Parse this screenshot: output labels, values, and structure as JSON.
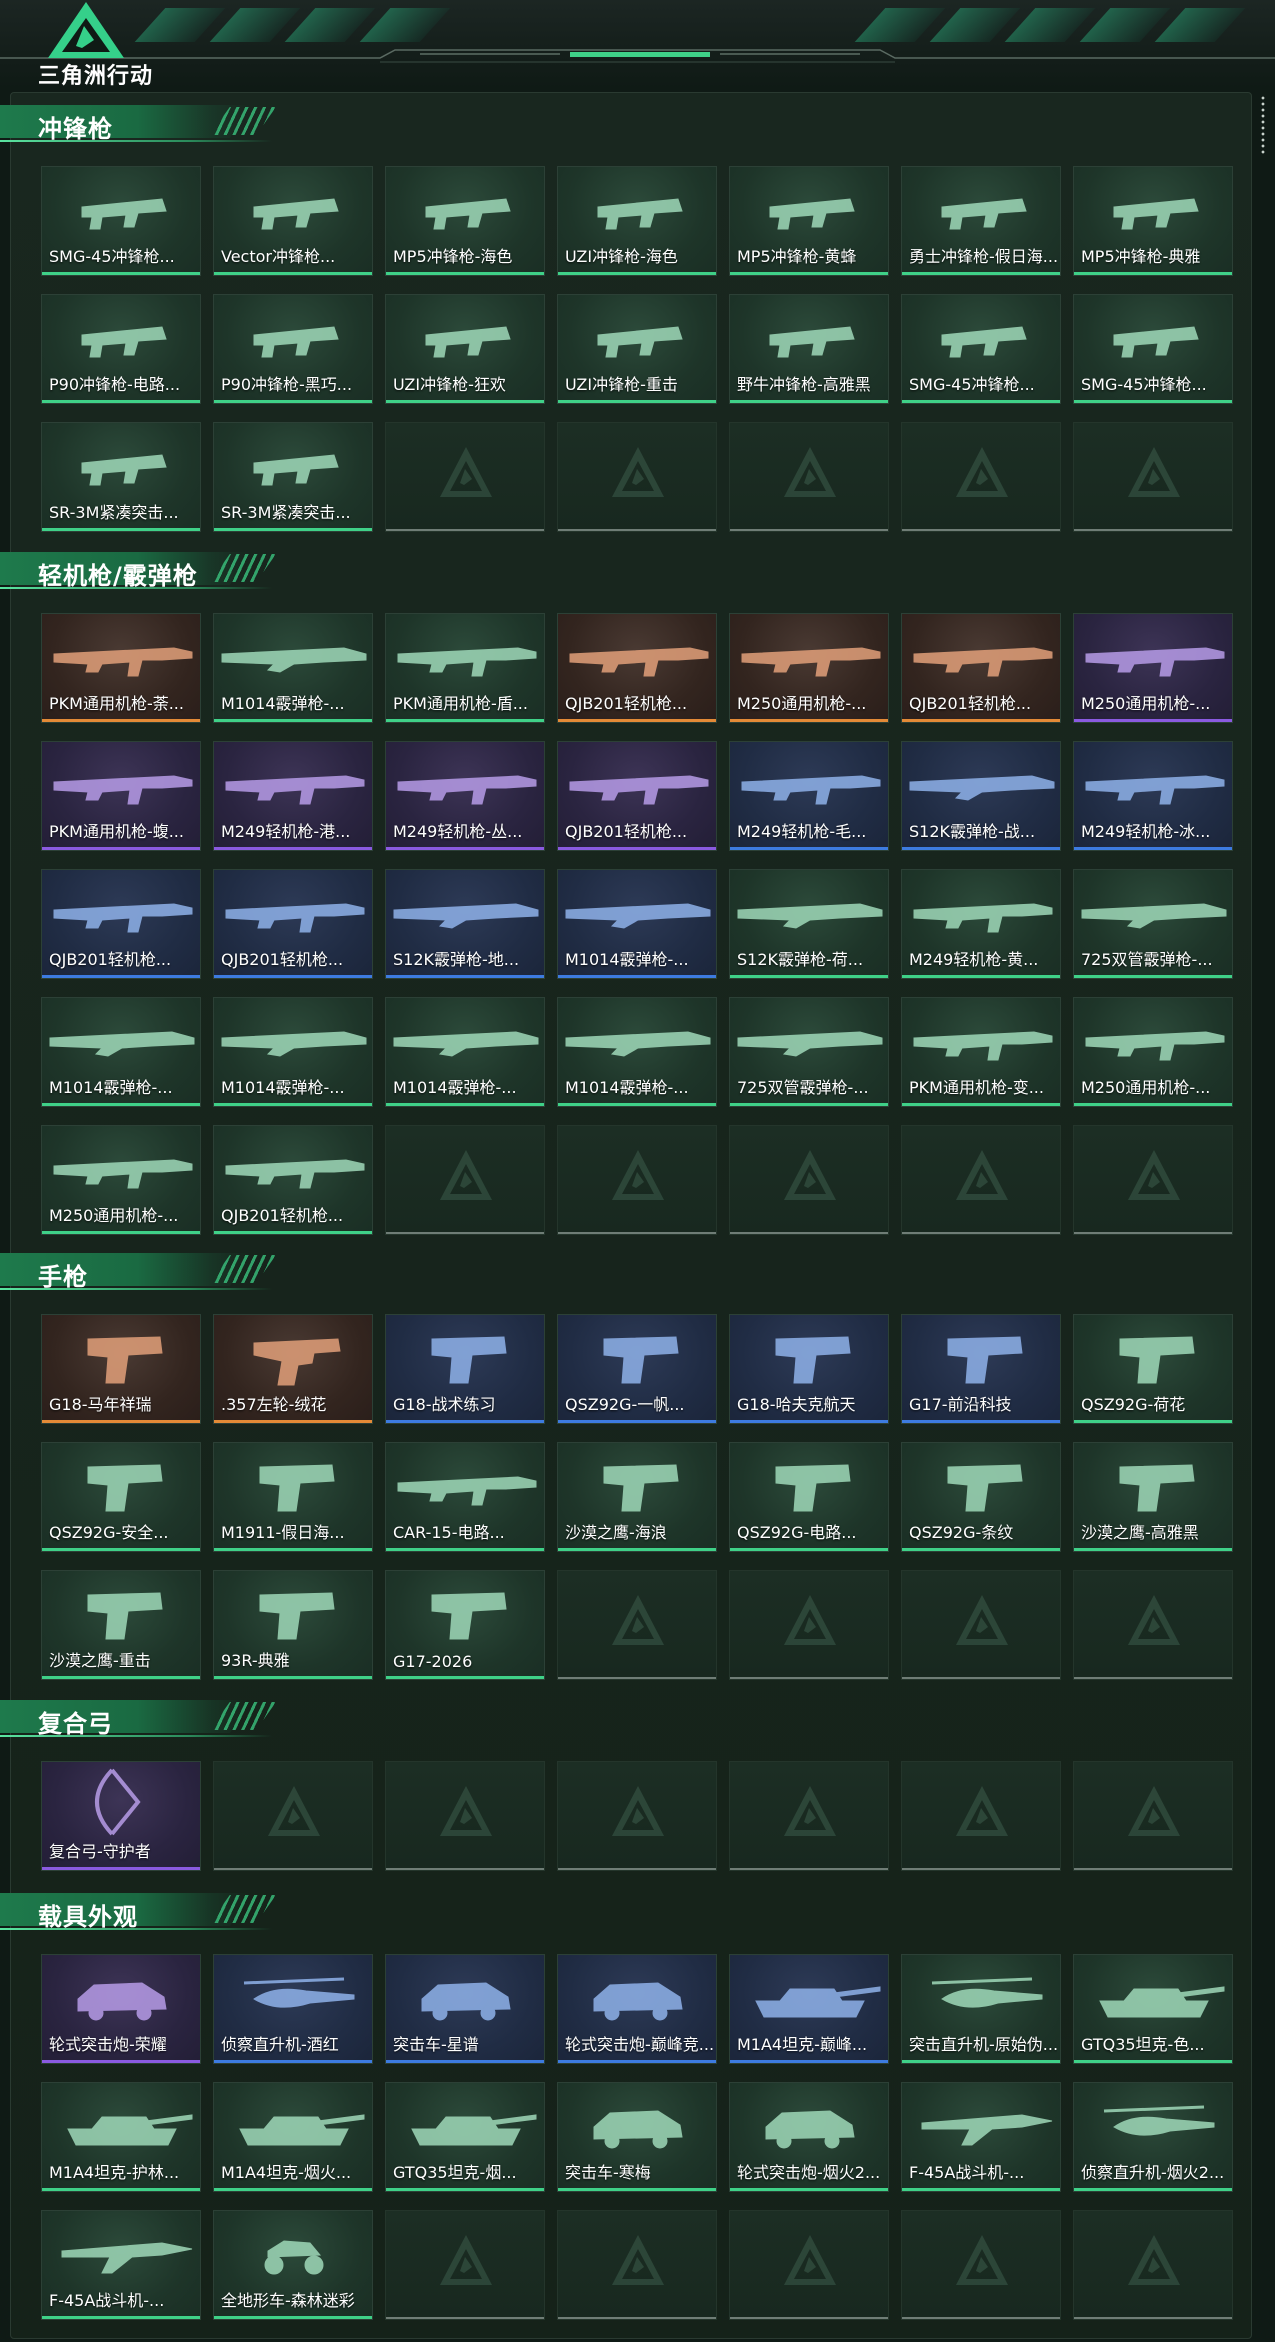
{
  "header": {
    "logo_text": "三角洲行动"
  },
  "colors": {
    "green": "#3fd188",
    "orange": "#e38a37",
    "purple": "#8a5ae0",
    "blue": "#3d7be0"
  },
  "sections": [
    {
      "title": "冲锋枪",
      "items": [
        {
          "name": "SMG-45冲锋枪...",
          "rarity": "green",
          "icon": "smg-icon"
        },
        {
          "name": "Vector冲锋枪...",
          "rarity": "green",
          "icon": "smg-icon"
        },
        {
          "name": "MP5冲锋枪-海色",
          "rarity": "green",
          "icon": "smg-icon"
        },
        {
          "name": "UZI冲锋枪-海色",
          "rarity": "green",
          "icon": "smg-icon"
        },
        {
          "name": "MP5冲锋枪-黄蜂",
          "rarity": "green",
          "icon": "smg-icon"
        },
        {
          "name": "勇士冲锋枪-假日海...",
          "rarity": "green",
          "icon": "smg-icon"
        },
        {
          "name": "MP5冲锋枪-典雅",
          "rarity": "green",
          "icon": "smg-icon"
        },
        {
          "name": "P90冲锋枪-电路...",
          "rarity": "green",
          "icon": "smg-icon"
        },
        {
          "name": "P90冲锋枪-黑巧...",
          "rarity": "green",
          "icon": "smg-icon"
        },
        {
          "name": "UZI冲锋枪-狂欢",
          "rarity": "green",
          "icon": "smg-icon"
        },
        {
          "name": "UZI冲锋枪-重击",
          "rarity": "green",
          "icon": "smg-icon"
        },
        {
          "name": "野牛冲锋枪-高雅黑",
          "rarity": "green",
          "icon": "smg-icon"
        },
        {
          "name": "SMG-45冲锋枪...",
          "rarity": "green",
          "icon": "smg-icon"
        },
        {
          "name": "SMG-45冲锋枪...",
          "rarity": "green",
          "icon": "smg-icon"
        },
        {
          "name": "SR-3M紧凑突击...",
          "rarity": "green",
          "icon": "smg-icon"
        },
        {
          "name": "SR-3M紧凑突击...",
          "rarity": "green",
          "icon": "smg-icon"
        }
      ],
      "rows": 3
    },
    {
      "title": "轻机枪/霰弹枪",
      "items": [
        {
          "name": "PKM通用机枪-荼...",
          "rarity": "orange",
          "icon": "rifle-icon"
        },
        {
          "name": "M1014霰弹枪-...",
          "rarity": "green",
          "icon": "shotgun-icon"
        },
        {
          "name": "PKM通用机枪-盾...",
          "rarity": "green",
          "icon": "rifle-icon"
        },
        {
          "name": "QJB201轻机枪...",
          "rarity": "orange",
          "icon": "rifle-icon"
        },
        {
          "name": "M250通用机枪-...",
          "rarity": "orange",
          "icon": "rifle-icon"
        },
        {
          "name": "QJB201轻机枪...",
          "rarity": "orange",
          "icon": "rifle-icon"
        },
        {
          "name": "M250通用机枪-...",
          "rarity": "purple",
          "icon": "rifle-icon"
        },
        {
          "name": "PKM通用机枪-蝮...",
          "rarity": "purple",
          "icon": "rifle-icon"
        },
        {
          "name": "M249轻机枪-港...",
          "rarity": "purple",
          "icon": "rifle-icon"
        },
        {
          "name": "M249轻机枪-丛...",
          "rarity": "purple",
          "icon": "rifle-icon"
        },
        {
          "name": "QJB201轻机枪...",
          "rarity": "purple",
          "icon": "rifle-icon"
        },
        {
          "name": "M249轻机枪-毛...",
          "rarity": "blue",
          "icon": "rifle-icon"
        },
        {
          "name": "S12K霰弹枪-战...",
          "rarity": "blue",
          "icon": "shotgun-icon"
        },
        {
          "name": "M249轻机枪-冰...",
          "rarity": "blue",
          "icon": "rifle-icon"
        },
        {
          "name": "QJB201轻机枪...",
          "rarity": "blue",
          "icon": "rifle-icon"
        },
        {
          "name": "QJB201轻机枪...",
          "rarity": "blue",
          "icon": "rifle-icon"
        },
        {
          "name": "S12K霰弹枪-地...",
          "rarity": "blue",
          "icon": "shotgun-icon"
        },
        {
          "name": "M1014霰弹枪-...",
          "rarity": "blue",
          "icon": "shotgun-icon"
        },
        {
          "name": "S12K霰弹枪-荷...",
          "rarity": "green",
          "icon": "shotgun-icon"
        },
        {
          "name": "M249轻机枪-黄...",
          "rarity": "green",
          "icon": "rifle-icon"
        },
        {
          "name": "725双管霰弹枪-...",
          "rarity": "green",
          "icon": "shotgun-icon"
        },
        {
          "name": "M1014霰弹枪-...",
          "rarity": "green",
          "icon": "shotgun-icon"
        },
        {
          "name": "M1014霰弹枪-...",
          "rarity": "green",
          "icon": "shotgun-icon"
        },
        {
          "name": "M1014霰弹枪-...",
          "rarity": "green",
          "icon": "shotgun-icon"
        },
        {
          "name": "M1014霰弹枪-...",
          "rarity": "green",
          "icon": "shotgun-icon"
        },
        {
          "name": "725双管霰弹枪-...",
          "rarity": "green",
          "icon": "shotgun-icon"
        },
        {
          "name": "PKM通用机枪-变...",
          "rarity": "green",
          "icon": "rifle-icon"
        },
        {
          "name": "M250通用机枪-...",
          "rarity": "green",
          "icon": "rifle-icon"
        },
        {
          "name": "M250通用机枪-...",
          "rarity": "green",
          "icon": "rifle-icon"
        },
        {
          "name": "QJB201轻机枪...",
          "rarity": "green",
          "icon": "rifle-icon"
        }
      ],
      "rows": 5
    },
    {
      "title": "手枪",
      "items": [
        {
          "name": "G18-马年祥瑞",
          "rarity": "orange",
          "icon": "pistol-icon"
        },
        {
          "name": ".357左轮-绒花",
          "rarity": "orange",
          "icon": "revolver-icon"
        },
        {
          "name": "G18-战术练习",
          "rarity": "blue",
          "icon": "pistol-icon"
        },
        {
          "name": "QSZ92G-一帆...",
          "rarity": "blue",
          "icon": "pistol-icon"
        },
        {
          "name": "G18-哈夫克航天",
          "rarity": "blue",
          "icon": "pistol-icon"
        },
        {
          "name": "G17-前沿科技",
          "rarity": "blue",
          "icon": "pistol-icon"
        },
        {
          "name": "QSZ92G-荷花",
          "rarity": "green",
          "icon": "pistol-icon"
        },
        {
          "name": "QSZ92G-安全...",
          "rarity": "green",
          "icon": "pistol-icon"
        },
        {
          "name": "M1911-假日海...",
          "rarity": "green",
          "icon": "pistol-icon"
        },
        {
          "name": "CAR-15-电路...",
          "rarity": "green",
          "icon": "rifle-icon"
        },
        {
          "name": "沙漠之鹰-海浪",
          "rarity": "green",
          "icon": "pistol-icon"
        },
        {
          "name": "QSZ92G-电路...",
          "rarity": "green",
          "icon": "pistol-icon"
        },
        {
          "name": "QSZ92G-条纹",
          "rarity": "green",
          "icon": "pistol-icon"
        },
        {
          "name": "沙漠之鹰-高雅黑",
          "rarity": "green",
          "icon": "pistol-icon"
        },
        {
          "name": "沙漠之鹰-重击",
          "rarity": "green",
          "icon": "pistol-icon"
        },
        {
          "name": "93R-典雅",
          "rarity": "green",
          "icon": "pistol-icon"
        },
        {
          "name": "G17-2026",
          "rarity": "green",
          "icon": "pistol-icon"
        }
      ],
      "rows": 3
    },
    {
      "title": "复合弓",
      "items": [
        {
          "name": "复合弓-守护者",
          "rarity": "purple",
          "icon": "bow-icon"
        }
      ],
      "rows": 1
    },
    {
      "title": "载具外观",
      "items": [
        {
          "name": "轮式突击炮-荣耀",
          "rarity": "purple",
          "icon": "vehicle-icon"
        },
        {
          "name": "侦察直升机-酒红",
          "rarity": "blue",
          "icon": "helicopter-icon"
        },
        {
          "name": "突击车-星谱",
          "rarity": "blue",
          "icon": "vehicle-icon"
        },
        {
          "name": "轮式突击炮-巅峰竞...",
          "rarity": "blue",
          "icon": "vehicle-icon"
        },
        {
          "name": "M1A4坦克-巅峰...",
          "rarity": "blue",
          "icon": "tank-icon"
        },
        {
          "name": "突击直升机-原始伪...",
          "rarity": "green",
          "icon": "helicopter-icon"
        },
        {
          "name": "GTQ35坦克-色...",
          "rarity": "green",
          "icon": "tank-icon"
        },
        {
          "name": "M1A4坦克-护林...",
          "rarity": "green",
          "icon": "tank-icon"
        },
        {
          "name": "M1A4坦克-烟火...",
          "rarity": "green",
          "icon": "tank-icon"
        },
        {
          "name": "GTQ35坦克-烟...",
          "rarity": "green",
          "icon": "tank-icon"
        },
        {
          "name": "突击车-寒梅",
          "rarity": "green",
          "icon": "vehicle-icon"
        },
        {
          "name": "轮式突击炮-烟火2...",
          "rarity": "green",
          "icon": "vehicle-icon"
        },
        {
          "name": "F-45A战斗机-...",
          "rarity": "green",
          "icon": "jet-icon"
        },
        {
          "name": "侦察直升机-烟火2...",
          "rarity": "green",
          "icon": "helicopter-icon"
        },
        {
          "name": "F-45A战斗机-...",
          "rarity": "green",
          "icon": "jet-icon"
        },
        {
          "name": "全地形车-森林迷彩",
          "rarity": "green",
          "icon": "atv-icon"
        }
      ],
      "rows": 3
    }
  ]
}
